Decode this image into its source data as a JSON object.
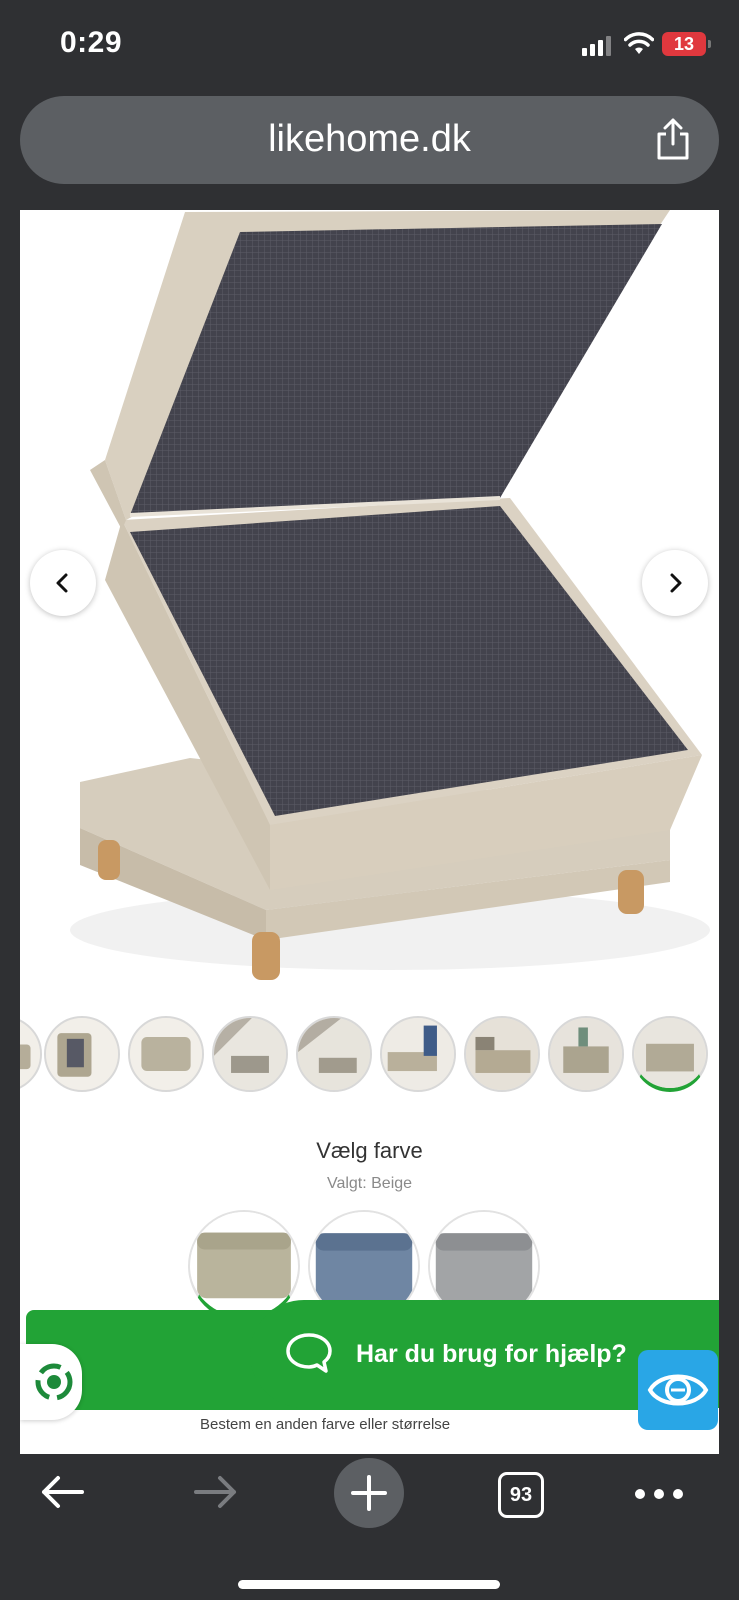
{
  "status_bar": {
    "time": "0:29",
    "battery": "13"
  },
  "browser": {
    "url": "likehome.dk",
    "tab_count": "93"
  },
  "product": {
    "color_title": "Vælg farve",
    "selected_color": "Valgt: Beige",
    "colors": [
      {
        "name": "Beige",
        "hex": "#b9b49c"
      },
      {
        "name": "Blue",
        "hex": "#6f86a3"
      },
      {
        "name": "Grey",
        "hex": "#a2a4a6"
      }
    ]
  },
  "cart": {
    "subtext": "Bestem en anden farve eller størrelse"
  },
  "help": {
    "label": "Har du brug for hjælp?"
  },
  "colors": {
    "accent_green": "#22a336",
    "promo_yellow": "#ffef00",
    "accessibility_blue": "#29a6e6"
  }
}
